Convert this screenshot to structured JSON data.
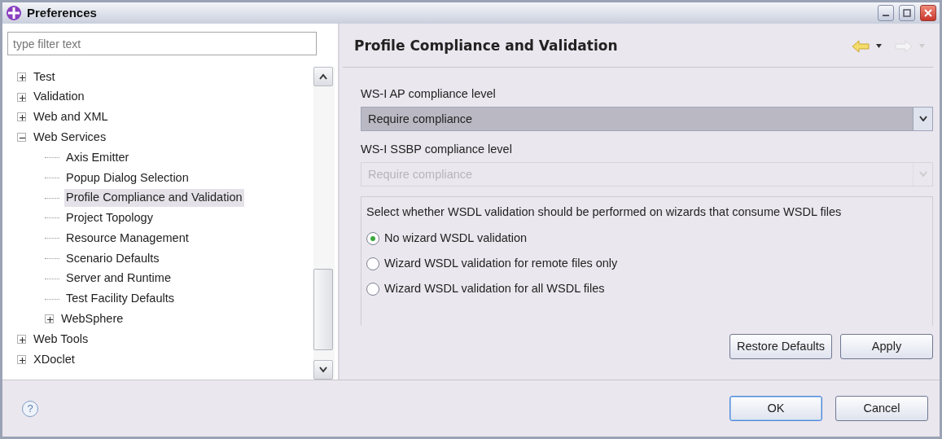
{
  "window": {
    "title": "Preferences"
  },
  "filter": {
    "placeholder": "type filter text"
  },
  "tree": [
    {
      "label": "Test",
      "expanded": false,
      "selected": false
    },
    {
      "label": "Validation",
      "expanded": false,
      "selected": false
    },
    {
      "label": "Web and XML",
      "expanded": false,
      "selected": false
    },
    {
      "label": "Web Services",
      "expanded": true,
      "selected": false,
      "children": [
        {
          "label": "Axis Emitter",
          "selected": false
        },
        {
          "label": "Popup Dialog Selection",
          "selected": false
        },
        {
          "label": "Profile Compliance and Validation",
          "selected": true
        },
        {
          "label": "Project Topology",
          "selected": false
        },
        {
          "label": "Resource Management",
          "selected": false
        },
        {
          "label": "Scenario Defaults",
          "selected": false
        },
        {
          "label": "Server and Runtime",
          "selected": false
        },
        {
          "label": "Test Facility Defaults",
          "selected": false
        },
        {
          "label": "WebSphere",
          "expanded": false,
          "selected": false
        }
      ]
    },
    {
      "label": "Web Tools",
      "expanded": false,
      "selected": false
    },
    {
      "label": "XDoclet",
      "expanded": false,
      "selected": false
    }
  ],
  "page": {
    "title": "Profile Compliance and Validation",
    "fields": [
      {
        "label": "WS-I AP compliance level",
        "value": "Require compliance",
        "disabled": false
      },
      {
        "label": "WS-I SSBP compliance level",
        "value": "Require compliance",
        "disabled": true
      }
    ],
    "group": {
      "label": "Select whether WSDL validation should be performed on wizards that consume WSDL files",
      "options": [
        {
          "label": "No wizard WSDL validation",
          "selected": true
        },
        {
          "label": "Wizard WSDL validation for remote files only",
          "selected": false
        },
        {
          "label": "Wizard WSDL validation for all WSDL files",
          "selected": false
        }
      ]
    },
    "buttons": [
      "Restore Defaults",
      "Apply"
    ]
  },
  "help": "?",
  "dialog_buttons": [
    "OK",
    "Cancel"
  ]
}
